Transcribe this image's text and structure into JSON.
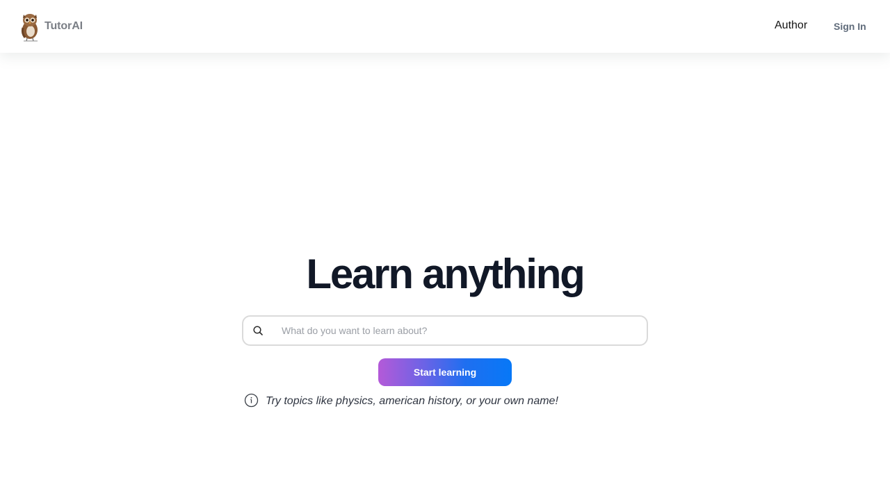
{
  "header": {
    "brand": {
      "name": "TutorAI",
      "logo_icon": "owl-emoji"
    },
    "nav": [
      {
        "label": "Author"
      },
      {
        "label": "Sign In"
      }
    ]
  },
  "hero": {
    "title": "Learn anything",
    "search": {
      "icon": "search-icon",
      "placeholder": "What do you want to learn about?",
      "value": ""
    },
    "start_button": {
      "label": "Start learning"
    },
    "hint": {
      "icon": "info-icon",
      "text": "Try topics like physics, american history, or your own name!"
    }
  },
  "colors": {
    "title": "#111827",
    "brand_text": "#7b7f86",
    "signin_text": "#5f6b7a",
    "button_gradient_start": "#b45ad8",
    "button_gradient_end": "#0778f7",
    "search_border": "#dadada"
  }
}
